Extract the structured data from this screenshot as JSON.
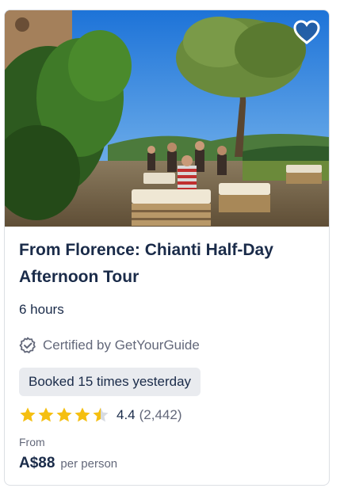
{
  "card": {
    "title": "From Florence: Chianti Half-Day Afternoon Tour",
    "duration": "6 hours",
    "certified_label": "Certified by GetYourGuide",
    "badge": "Booked 15 times yesterday",
    "rating_value": "4.4",
    "rating_count": "(2,442)",
    "rating_stars": 4.4,
    "price_from_label": "From",
    "price": "A$88",
    "price_unit": "per person"
  },
  "icons": {
    "wishlist": "heart-icon",
    "certified": "shield-check-icon",
    "star": "star-icon"
  },
  "colors": {
    "text_primary": "#1a2b49",
    "text_secondary": "#63687a",
    "star": "#f5bf10",
    "badge_bg": "#e9ebef"
  }
}
